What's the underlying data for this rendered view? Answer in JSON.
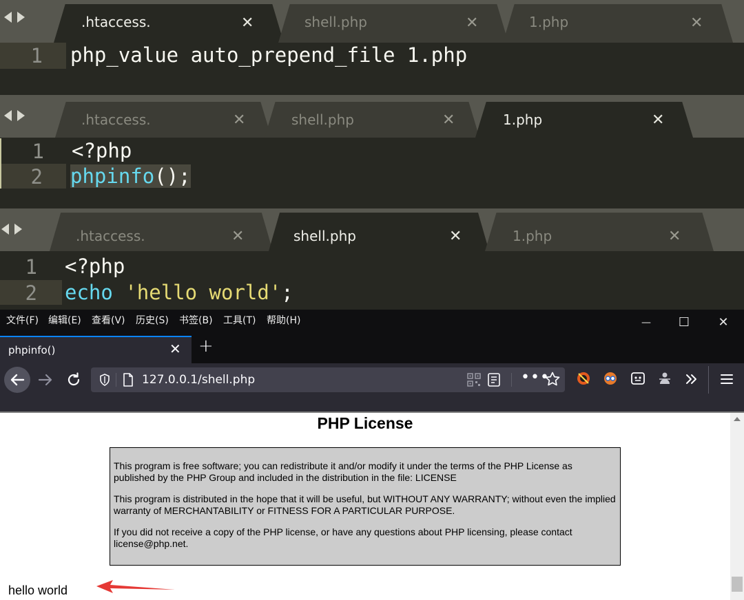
{
  "editors": [
    {
      "tabs": [
        {
          "label": ".htaccess.",
          "close": "✕",
          "active": true
        },
        {
          "label": "shell.php",
          "close": "✕",
          "active": false
        },
        {
          "label": "1.php",
          "close": "✕",
          "active": false
        }
      ],
      "lines": [
        {
          "num": "1",
          "text": "php_value auto_prepend_file 1.php"
        }
      ]
    },
    {
      "tabs": [
        {
          "label": ".htaccess.",
          "close": "✕",
          "active": false
        },
        {
          "label": "shell.php",
          "close": "✕",
          "active": false
        },
        {
          "label": "1.php",
          "close": "✕",
          "active": true
        }
      ],
      "lines": [
        {
          "num": "1",
          "text": "<?php"
        },
        {
          "num": "2",
          "fn": "phpinfo",
          "rest": "();"
        }
      ]
    },
    {
      "tabs": [
        {
          "label": ".htaccess.",
          "close": "✕",
          "active": false
        },
        {
          "label": "shell.php",
          "close": "✕",
          "active": true
        },
        {
          "label": "1.php",
          "close": "✕",
          "active": false
        }
      ],
      "lines": [
        {
          "num": "1",
          "text": "<?php"
        },
        {
          "num": "2",
          "kw": "echo",
          "str": "'hello world'",
          "end": ";"
        }
      ]
    }
  ],
  "browser": {
    "menu": [
      "文件(F)",
      "编辑(E)",
      "查看(V)",
      "历史(S)",
      "书签(B)",
      "工具(T)",
      "帮助(H)"
    ],
    "window_controls": {
      "minimize": "—",
      "maximize": "☐",
      "close": "✕"
    },
    "tab": {
      "title": "phpinfo()",
      "close": "✕",
      "new_tab": "+"
    },
    "url": "127.0.0.1/shell.php",
    "toolbar_icons": [
      "back-icon",
      "forward-icon",
      "reload-icon",
      "shield-icon",
      "page-icon",
      "qr-icon",
      "reader-icon",
      "more-icon",
      "star-icon",
      "extension-icons",
      "overflow-icon",
      "menu-icon"
    ],
    "page": {
      "heading": "PHP License",
      "paragraphs": [
        "This program is free software; you can redistribute it and/or modify it under the terms of the PHP License as published by the PHP Group and included in the distribution in the file: LICENSE",
        "This program is distributed in the hope that it will be useful, but WITHOUT ANY WARRANTY; without even the implied warranty of MERCHANTABILITY or FITNESS FOR A PARTICULAR PURPOSE.",
        "If you did not receive a copy of the PHP license, or have any questions about PHP licensing, please contact license@php.net."
      ],
      "output": "hello world"
    }
  },
  "colors": {
    "editor_bg": "#272822",
    "keyword_blue": "#66d9ef",
    "string_yellow": "#e6db74",
    "arrow_red": "#e53935",
    "firefox_dark": "#2b2a33"
  }
}
